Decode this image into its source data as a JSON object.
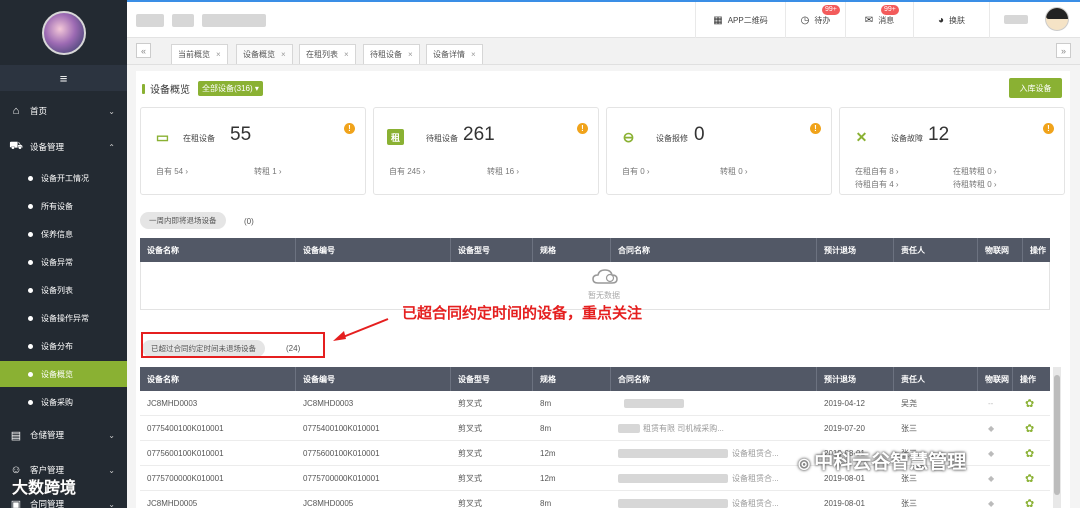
{
  "sidebar": {
    "menu_toggle": "≡",
    "groups": [
      {
        "label": "首页",
        "icon": "home-icon",
        "icon_glyph": "⌂",
        "caret": "⌄"
      },
      {
        "label": "设备管理",
        "icon": "equipment-icon",
        "icon_glyph": "⛟",
        "caret": "⌃"
      },
      {
        "label": "仓储管理",
        "icon": "warehouse-icon",
        "icon_glyph": "▤",
        "caret": "⌄"
      },
      {
        "label": "客户管理",
        "icon": "customer-icon",
        "icon_glyph": "☺",
        "caret": "⌄"
      },
      {
        "label": "合同管理",
        "icon": "contract-icon",
        "icon_glyph": "▣",
        "caret": "⌄"
      }
    ],
    "sub_items": [
      {
        "label": "设备开工情况"
      },
      {
        "label": "所有设备"
      },
      {
        "label": "保养信息"
      },
      {
        "label": "设备异常"
      },
      {
        "label": "设备列表"
      },
      {
        "label": "设备操作异常"
      },
      {
        "label": "设备分布"
      },
      {
        "label": "设备概览"
      },
      {
        "label": "设备采购"
      }
    ],
    "active_item": "设备概览",
    "accent_color": "#8ab133"
  },
  "header": {
    "buttons": [
      {
        "label": "APP二维码",
        "icon": "qrcode-icon",
        "glyph": "▦"
      },
      {
        "label": "待办",
        "icon": "clock-icon",
        "glyph": "◷",
        "badge": "99+"
      },
      {
        "label": "消息",
        "icon": "mail-icon",
        "glyph": "✉",
        "badge": "99+"
      },
      {
        "label": "换肤",
        "icon": "palette-icon",
        "glyph": "◕"
      }
    ]
  },
  "tabs": [
    {
      "label": "当前概览"
    },
    {
      "label": "设备概览",
      "active": true
    },
    {
      "label": "在租列表"
    },
    {
      "label": "待租设备"
    },
    {
      "label": "设备详情"
    }
  ],
  "tab_close": "×",
  "tab_prev": "«",
  "tab_next": "»",
  "overview": {
    "title": "设备概览",
    "filter": "全部设备(316) ▾",
    "add_button": "入库设备",
    "cards": [
      {
        "label": "在租设备",
        "value": "55",
        "icon": "rented-equipment-icon",
        "glyph": "▭",
        "subs": [
          "自有 54 ›",
          "转租 1 ›"
        ]
      },
      {
        "label": "待租设备",
        "value": "261",
        "icon": "lease-pending-icon",
        "glyph": "租",
        "subs": [
          "自有 245 ›",
          "转租 16 ›"
        ]
      },
      {
        "label": "设备报修",
        "value": "0",
        "icon": "repair-report-icon",
        "glyph": "⊖",
        "subs": [
          "自有 0 ›",
          "转租 0 ›"
        ]
      },
      {
        "label": "设备故障",
        "value": "12",
        "icon": "wrench-icon",
        "glyph": "✕",
        "subs": [
          "在租自有 8 ›",
          "在租转租 0 ›",
          "待租自有 4 ›",
          "待租转租 0 ›"
        ]
      }
    ],
    "warn_glyph": "!"
  },
  "section_week": {
    "pill": "一周内即将退场设备",
    "count": "(0)",
    "headers": [
      "设备名称",
      "设备编号",
      "设备型号",
      "规格",
      "合同名称",
      "预计退场",
      "责任人",
      "物联网",
      "操作"
    ],
    "empty_text": "暂无数据"
  },
  "section_overdue": {
    "pill": "已超过合同约定时间未退场设备",
    "count": "(24)",
    "headers": [
      "设备名称",
      "设备编号",
      "设备型号",
      "规格",
      "合同名称",
      "预计退场",
      "责任人",
      "物联网",
      "操作"
    ],
    "rows": [
      {
        "name": "JC8MHD0003",
        "code": "JC8MHD0003",
        "model": "剪叉式",
        "spec": "8m",
        "contract": "",
        "exit_date": "2019-04-12",
        "owner": "吴尧",
        "iot": "--"
      },
      {
        "name": "0775400100K010001",
        "code": "0775400100K010001",
        "model": "剪叉式",
        "spec": "8m",
        "contract": "租赁有限  司机械采购...",
        "exit_date": "2019-07-20",
        "owner": "张三",
        "iot": "◆"
      },
      {
        "name": "0775600100K010001",
        "code": "0775600100K010001",
        "model": "剪叉式",
        "spec": "12m",
        "contract": "设备租赁合...",
        "exit_date": "2019-08-01",
        "owner": "张三",
        "iot": "◆"
      },
      {
        "name": "0775700000K010001",
        "code": "0775700000K010001",
        "model": "剪叉式",
        "spec": "12m",
        "contract": "设备租赁合...",
        "exit_date": "2019-08-01",
        "owner": "张三",
        "iot": "◆"
      },
      {
        "name": "JC8MHD0005",
        "code": "JC8MHD0005",
        "model": "剪叉式",
        "spec": "8m",
        "contract": "设备租赁合...",
        "exit_date": "2019-08-01",
        "owner": "张三",
        "iot": "◆"
      }
    ],
    "action_glyph": "✿"
  },
  "annotation": "已超合同约定时间的设备，重点关注",
  "watermark": "中科云谷智慧管理",
  "watermark_left": "大数跨境"
}
